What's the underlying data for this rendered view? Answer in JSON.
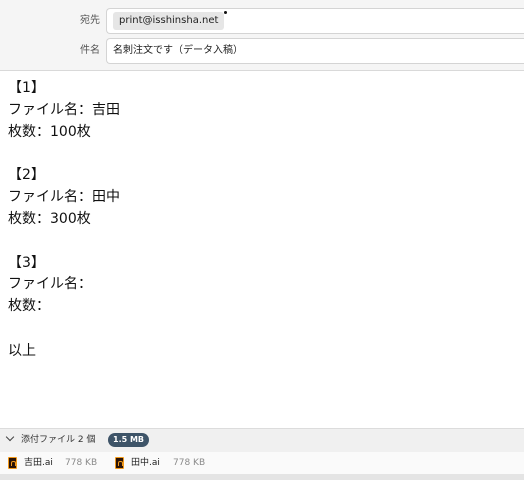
{
  "header": {
    "to_label": "宛先",
    "to_recipient": "print@isshinsha.net",
    "subject_label": "件名",
    "subject_value": "名刺注文です（データ入稿）"
  },
  "body": {
    "lines": [
      "【1】",
      "ファイル名：吉田",
      "枚数：100枚",
      "",
      "【2】",
      "ファイル名：田中",
      "枚数：300枚",
      "",
      "【3】",
      "ファイル名：",
      "枚数：",
      "",
      "以上"
    ]
  },
  "attachments": {
    "label": "添付ファイル 2 個",
    "total_size": "1.5 MB",
    "files": [
      {
        "name": "吉田.ai",
        "size": "778 KB",
        "icon": "illustrator-file-icon"
      },
      {
        "name": "田中.ai",
        "size": "778 KB",
        "icon": "illustrator-file-icon"
      }
    ]
  },
  "colors": {
    "header_bg": "#f5f5f5",
    "badge_bg": "#3e5468",
    "ai_icon_bg": "#2b1306",
    "ai_icon_accent": "#f29a1b"
  }
}
